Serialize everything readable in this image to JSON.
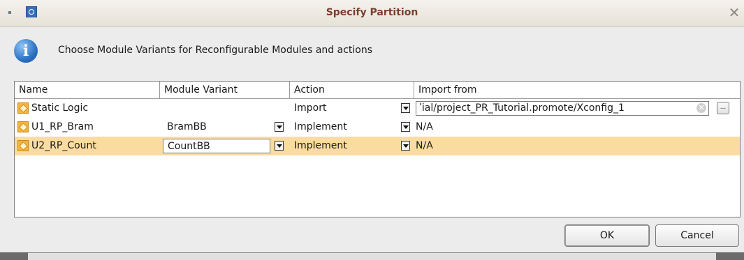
{
  "window": {
    "title": "Specify Partition",
    "close_glyph": "✕"
  },
  "message": "Choose Module Variants for Reconfigurable Modules and actions",
  "table": {
    "columns": [
      "Name",
      "Module Variant",
      "Action",
      "Import from"
    ],
    "rows": [
      {
        "name": "Static Logic",
        "variant": "",
        "action": "Import",
        "import_from": "ʹial/project_PR_Tutorial.promote/Xconfig_1",
        "selected": false
      },
      {
        "name": "U1_RP_Bram",
        "variant": "BramBB",
        "action": "Implement",
        "import_from": "N/A",
        "selected": false
      },
      {
        "name": "U2_RP_Count",
        "variant": "CountBB",
        "action": "Implement",
        "import_from": "N/A",
        "selected": true
      }
    ],
    "browse_label": "..."
  },
  "buttons": {
    "ok": "OK",
    "cancel": "Cancel"
  },
  "icons": {
    "info": "i",
    "clear": "✕"
  },
  "colors": {
    "selected_row": "#fbdca0",
    "title_text": "#7a3e2e",
    "info_blue": "#2c73c4"
  }
}
